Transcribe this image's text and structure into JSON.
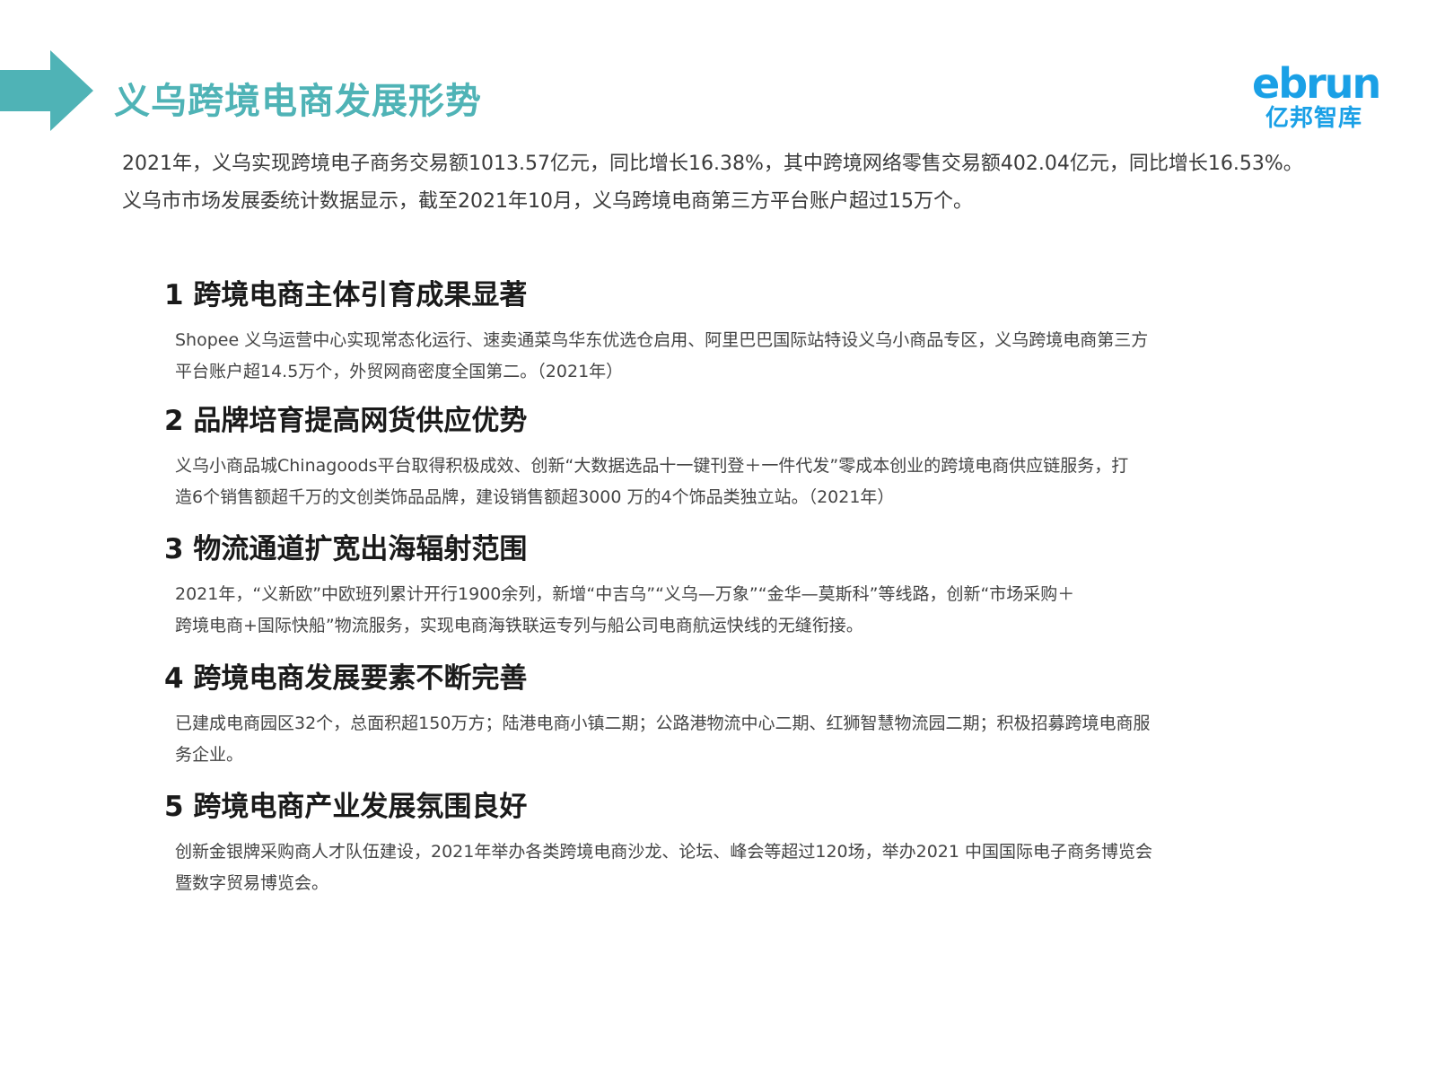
{
  "header": {
    "title": "义乌跨境电商发展形势",
    "arrow_color": "#4fb3b6",
    "icon": "arrow-right-icon"
  },
  "logo": {
    "word": "ebrun",
    "cn": "亿邦智库",
    "color": "#1aa0e6"
  },
  "intro": {
    "line1": "2021年，义乌实现跨境电子商务交易额1013.57亿元，同比增长16.38%，其中跨境网络零售交易额402.04亿元，同比增长16.53%。",
    "line2": "义乌市市场发展委统计数据显示，截至2021年10月，义乌跨境电商第三方平台账户超过15万个。"
  },
  "sections": [
    {
      "heading": "1 跨境电商主体引育成果显著",
      "line1": "Shopee 义乌运营中心实现常态化运行、速卖通菜鸟华东优选仓启用、阿里巴巴国际站特设义乌小商品专区，义乌跨境电商第三方",
      "line2": "平台账户超14.5万个，外贸网商密度全国第二。（2021年）"
    },
    {
      "heading": "2 品牌培育提高网货供应优势",
      "line1": "义乌小商品城Chinagoods平台取得积极成效、创新“大数据选品十一键刊登＋一件代发”零成本创业的跨境电商供应链服务，打",
      "line2": "造6个销售额超千万的文创类饰品品牌，建设销售额超3000 万的4个饰品类独立站。（2021年）"
    },
    {
      "heading": "3 物流通道扩宽出海辐射范围",
      "line1": "2021年，“义新欧”中欧班列累计开行1900余列，新增“中吉乌”“义乌—万象”“金华—莫斯科”等线路，创新“市场采购＋",
      "line2": "跨境电商+国际快船”物流服务，实现电商海铁联运专列与船公司电商航运快线的无缝衔接。"
    },
    {
      "heading": "4 跨境电商发展要素不断完善",
      "line1": "已建成电商园区32个，总面积超150万方；陆港电商小镇二期；公路港物流中心二期、红狮智慧物流园二期；积极招募跨境电商服",
      "line2": "务企业。"
    },
    {
      "heading": "5 跨境电商产业发展氛围良好",
      "line1": "创新金银牌采购商人才队伍建设，2021年举办各类跨境电商沙龙、论坛、峰会等超过120场，举办2021 中国国际电子商务博览会",
      "line2": "暨数字贸易博览会。"
    }
  ]
}
